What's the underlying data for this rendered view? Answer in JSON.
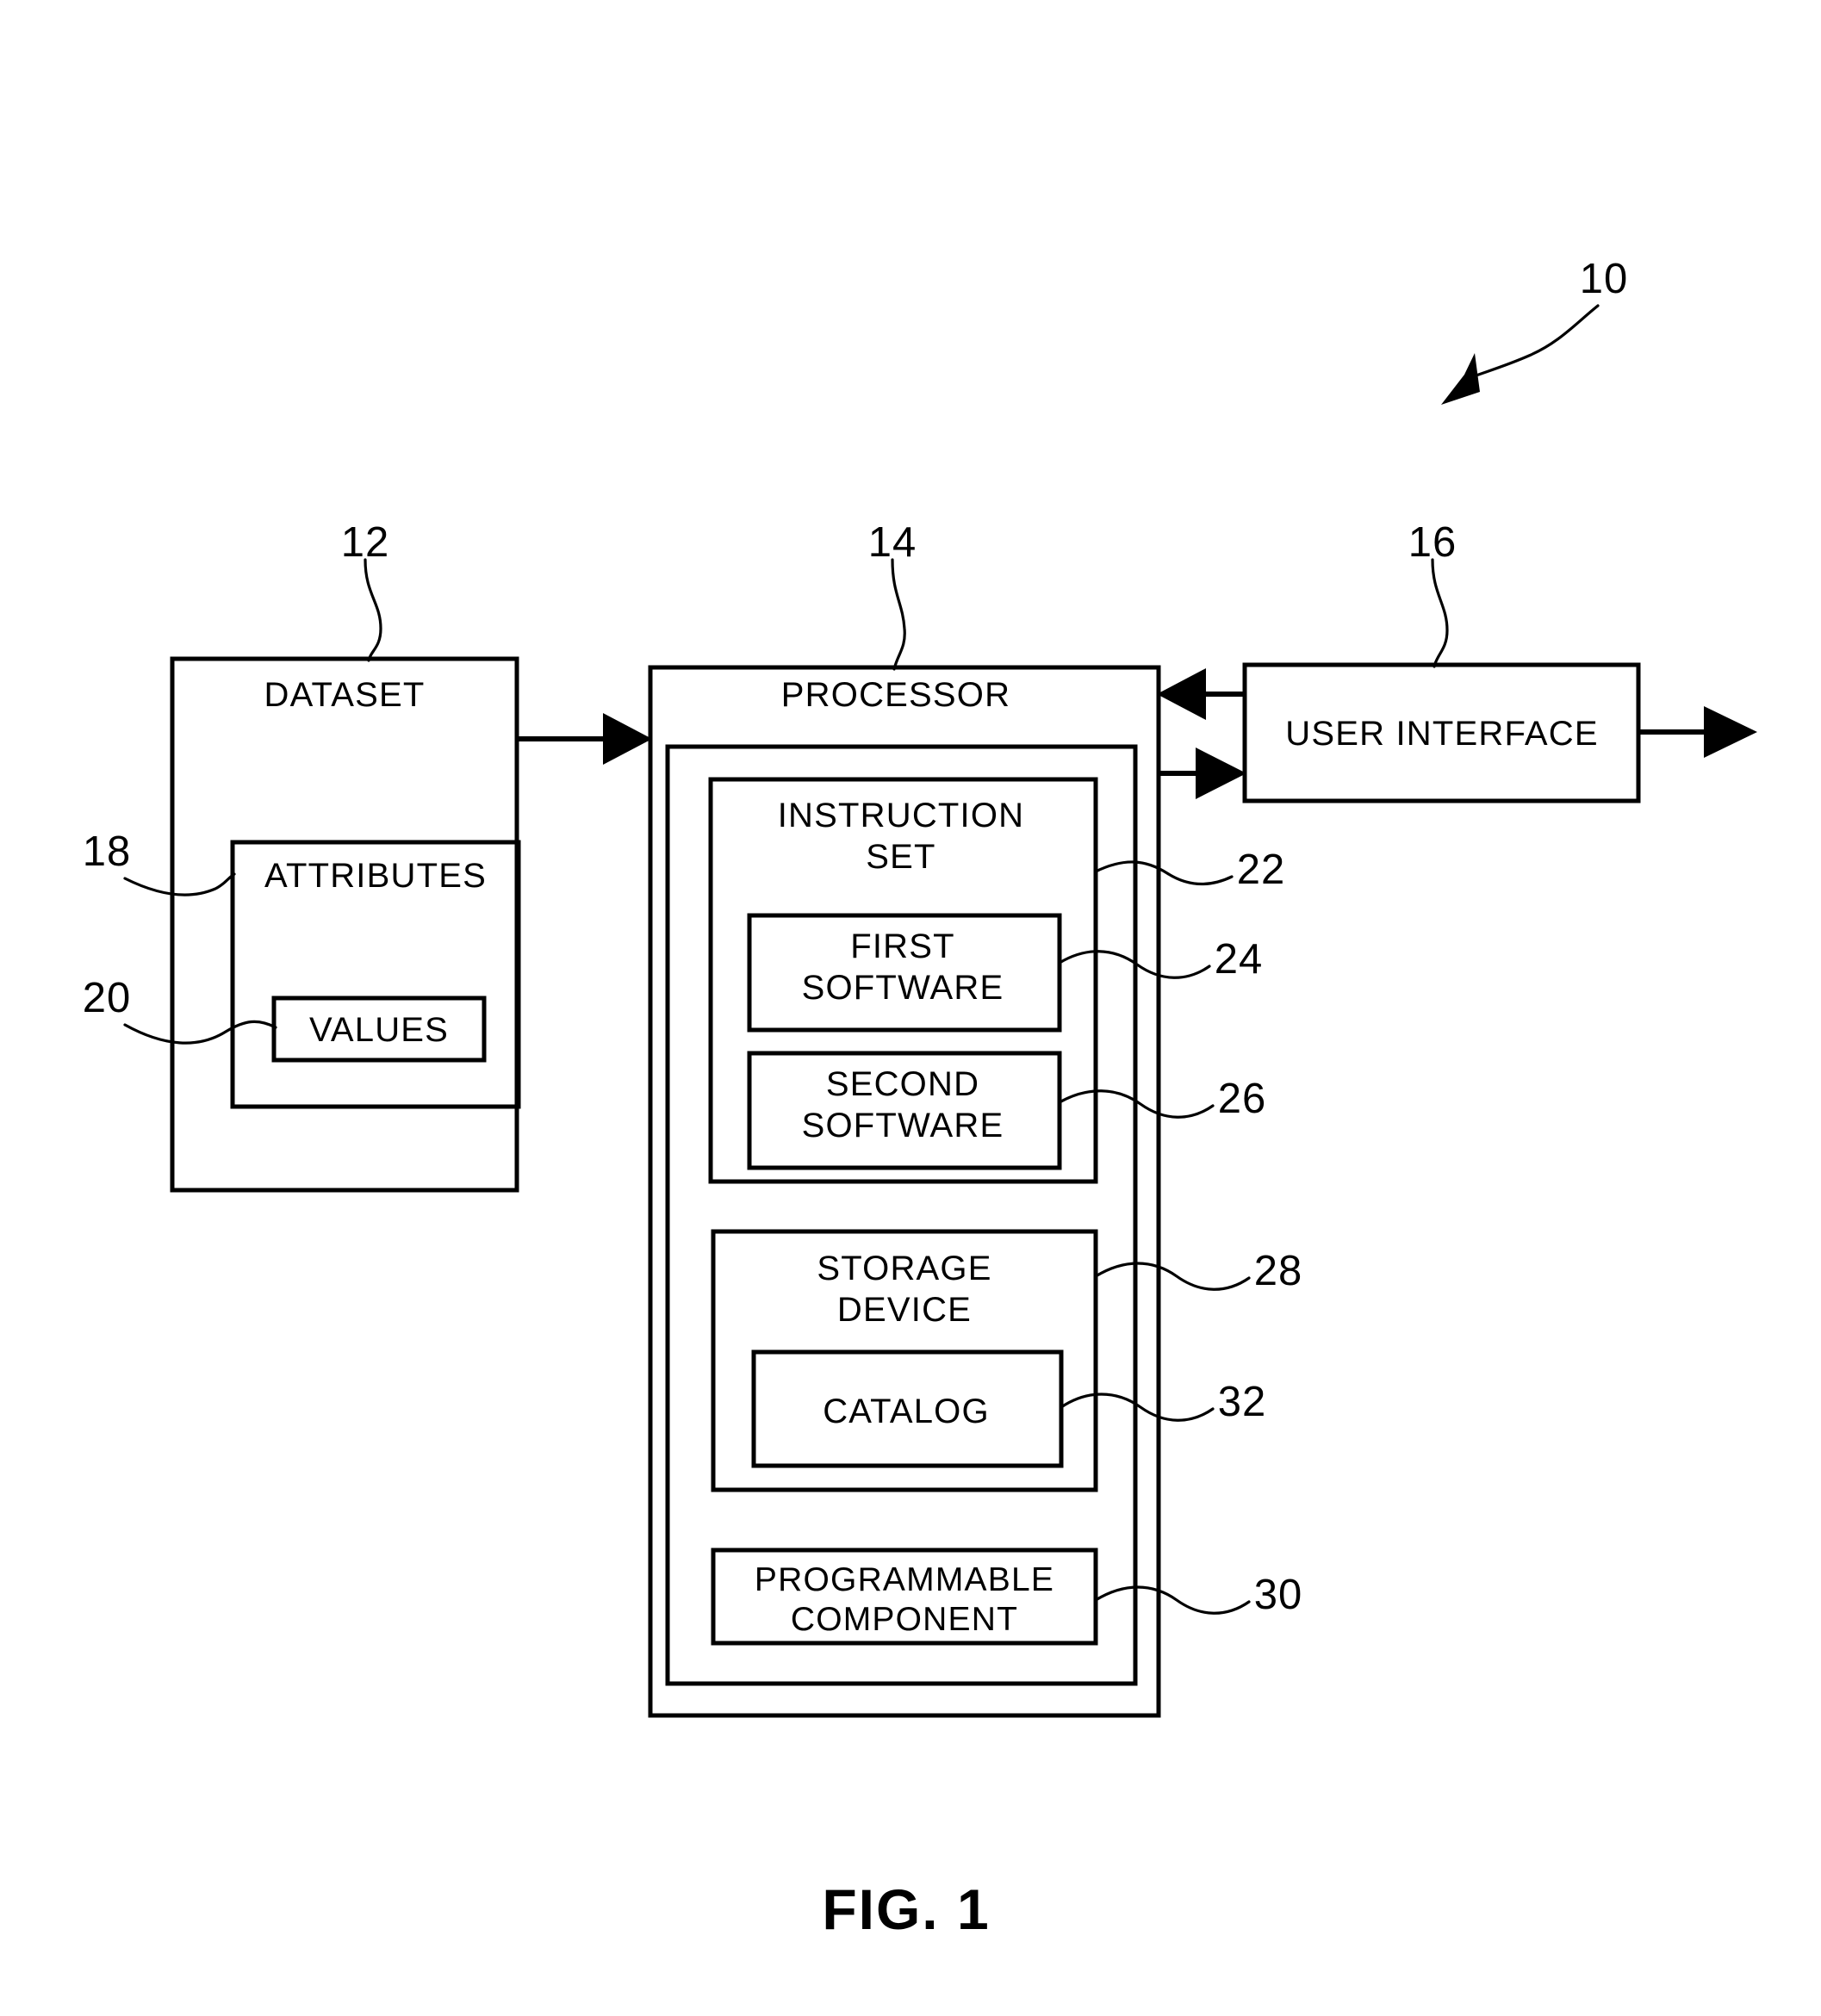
{
  "figure": {
    "caption": "FIG. 1",
    "overall_ref": "10"
  },
  "blocks": {
    "dataset": {
      "label": "DATASET",
      "ref": "12",
      "children": {
        "attributes": {
          "label": "ATTRIBUTES",
          "ref": "18"
        },
        "values": {
          "label": "VALUES",
          "ref": "20"
        }
      }
    },
    "processor": {
      "label": "PROCESSOR",
      "ref": "14",
      "children": {
        "instruction_set": {
          "label_line1": "INSTRUCTION",
          "label_line2": "SET",
          "ref": "22",
          "children": {
            "first_software": {
              "label_line1": "FIRST",
              "label_line2": "SOFTWARE",
              "ref": "24"
            },
            "second_software": {
              "label_line1": "SECOND",
              "label_line2": "SOFTWARE",
              "ref": "26"
            }
          }
        },
        "storage_device": {
          "label_line1": "STORAGE",
          "label_line2": "DEVICE",
          "ref": "28",
          "children": {
            "catalog": {
              "label": "CATALOG",
              "ref": "32"
            }
          }
        },
        "programmable_component": {
          "label_line1": "PROGRAMMABLE",
          "label_line2": "COMPONENT",
          "ref": "30"
        }
      }
    },
    "user_interface": {
      "label": "USER INTERFACE",
      "ref": "16"
    }
  },
  "colors": {
    "stroke": "#000000",
    "background": "#ffffff"
  }
}
